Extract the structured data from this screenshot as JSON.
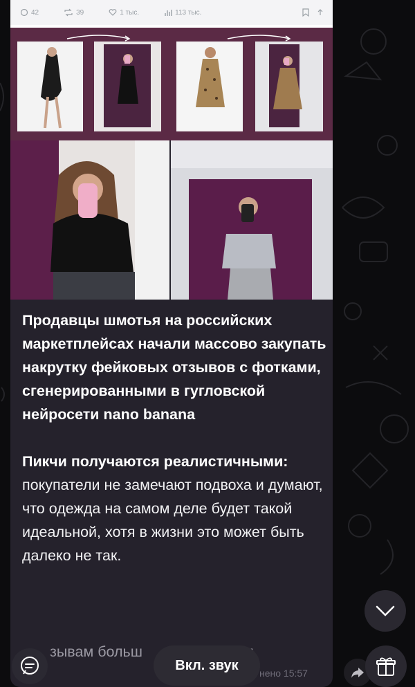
{
  "embedded_post": {
    "comments": "42",
    "reposts": "39",
    "likes": "1 тыс.",
    "views": "113 тыс."
  },
  "post": {
    "headline": "Продавцы шмотья на российских маркетплейсах начали массово закупать накрутку фейковых отзывов с фотками, сгенерированными в гугловской нейросети nano banana",
    "para2_bold": "Пикчи получаются реалистичными:",
    "para2_rest": " покупатели не замечают подвоха и думают, что одежда на самом деле будет такой идеальной, хотя в жизни это может быть далеко не так.",
    "faded_line": "зывам больш",
    "faded_tail": "ем",
    "time": "нено 15:57"
  },
  "controls": {
    "sound_button": "Вкл. звук"
  },
  "colors": {
    "bubble": "#25222c",
    "background": "#0c0c0e",
    "collage_bg": "#5b2a45"
  },
  "icons": [
    "comment-icon",
    "repost-icon",
    "heart-icon",
    "views-icon",
    "share-icon",
    "bookmark-icon",
    "forward-icon",
    "gift-icon",
    "scroll-down-icon",
    "chat-icon"
  ]
}
